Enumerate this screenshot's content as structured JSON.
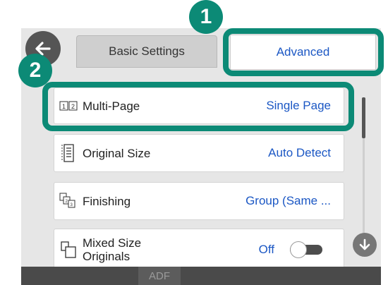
{
  "tabs": {
    "basic": "Basic Settings",
    "advanced": "Advanced"
  },
  "settings": [
    {
      "label": "Multi-Page",
      "value": "Single Page",
      "icon": "multi-page-icon"
    },
    {
      "label": "Original Size",
      "value": "Auto Detect",
      "icon": "original-size-icon"
    },
    {
      "label": "Finishing",
      "value": "Group (Same ...",
      "icon": "finishing-icon"
    },
    {
      "label": "Mixed Size\nOriginals",
      "value": "Off",
      "icon": "mixed-size-icon"
    }
  ],
  "bottom": {
    "adf": "ADF"
  },
  "callouts": [
    "1",
    "2"
  ],
  "colors": {
    "accent": "#0c8a76",
    "link": "#1b57c4"
  }
}
